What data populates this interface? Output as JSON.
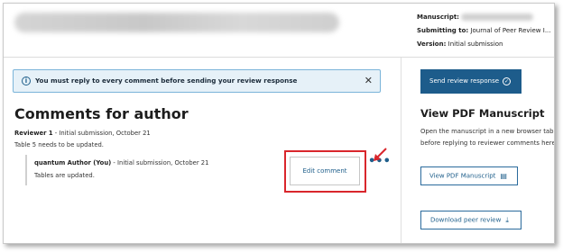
{
  "header": {
    "meta": [
      {
        "label": "Manuscript:",
        "value": ""
      },
      {
        "label": "Submitting to:",
        "value": "Journal of Peer Review I..."
      },
      {
        "label": "Version:",
        "value": "Initial submission"
      }
    ]
  },
  "alert": {
    "icon": "info-icon",
    "text": "You must reply to every comment before sending your review response",
    "close": "✕"
  },
  "comments": {
    "heading": "Comments for author",
    "reviewer": {
      "name": "Reviewer 1",
      "separator": " - ",
      "meta": "Initial submission, October 21",
      "body": "Table 5 needs to be updated."
    },
    "reply": {
      "name": "quantum Author (You)",
      "separator": " - ",
      "meta": "Initial submission, October 21",
      "body": "Tables are updated."
    },
    "edit_label": "Edit comment",
    "more_icon": "more-horizontal-icon"
  },
  "sidebar": {
    "send_label": "Send review response",
    "pdf_heading": "View PDF Manuscript",
    "pdf_desc": "Open the manuscript in a new browser tab before replying to reviewer comments here.",
    "view_label": "View PDF Manuscript",
    "download_label": "Download peer review"
  },
  "colors": {
    "primary": "#1d5c8b",
    "alert_bg": "#e6f1f8",
    "highlight": "#d9262c"
  }
}
